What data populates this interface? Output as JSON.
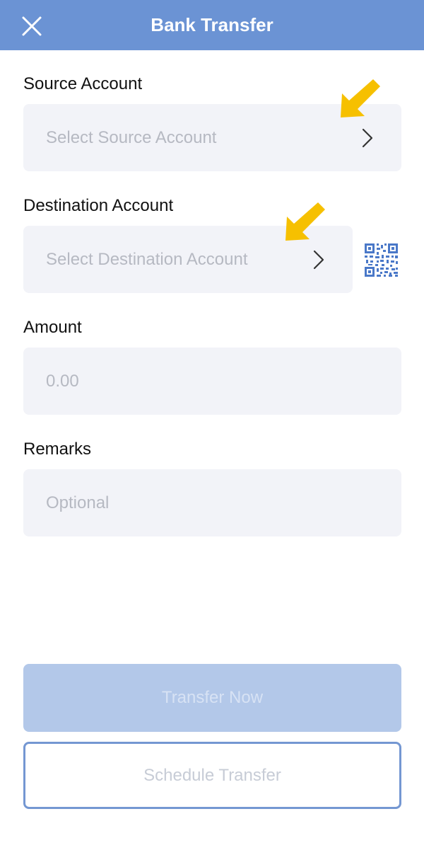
{
  "header": {
    "title": "Bank Transfer",
    "close_icon": "close-icon",
    "background_color": "#6b93d4"
  },
  "form": {
    "source": {
      "label": "Source Account",
      "placeholder": "Select Source Account"
    },
    "destination": {
      "label": "Destination Account",
      "placeholder": "Select Destination Account",
      "qr_icon": "qr-code-icon"
    },
    "amount": {
      "label": "Amount",
      "placeholder": "0.00"
    },
    "remarks": {
      "label": "Remarks",
      "placeholder": "Optional"
    }
  },
  "annotations": {
    "arrow_color": "#f6c000",
    "arrow_icon": "pointer-arrow-icon"
  },
  "actions": {
    "transfer_now": "Transfer Now",
    "schedule_transfer": "Schedule Transfer"
  }
}
